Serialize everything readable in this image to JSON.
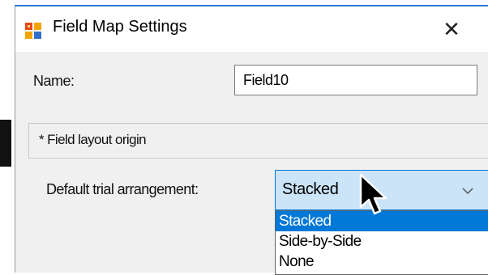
{
  "dialog": {
    "title": "Field Map Settings",
    "close_glyph": "✕",
    "app_icon": "field-map-app-icon"
  },
  "form": {
    "name_label": "Name:",
    "name_value": "Field10",
    "group_label": "* Field layout origin",
    "arrangement_label": "Default trial arrangement:",
    "arrangement_value": "Stacked",
    "arrangement_options": [
      "Stacked",
      "Side-by-Side",
      "None"
    ],
    "selected_option": "Stacked"
  },
  "colors": {
    "accent": "#0078d7",
    "combo_hover": "#cce4f7"
  }
}
